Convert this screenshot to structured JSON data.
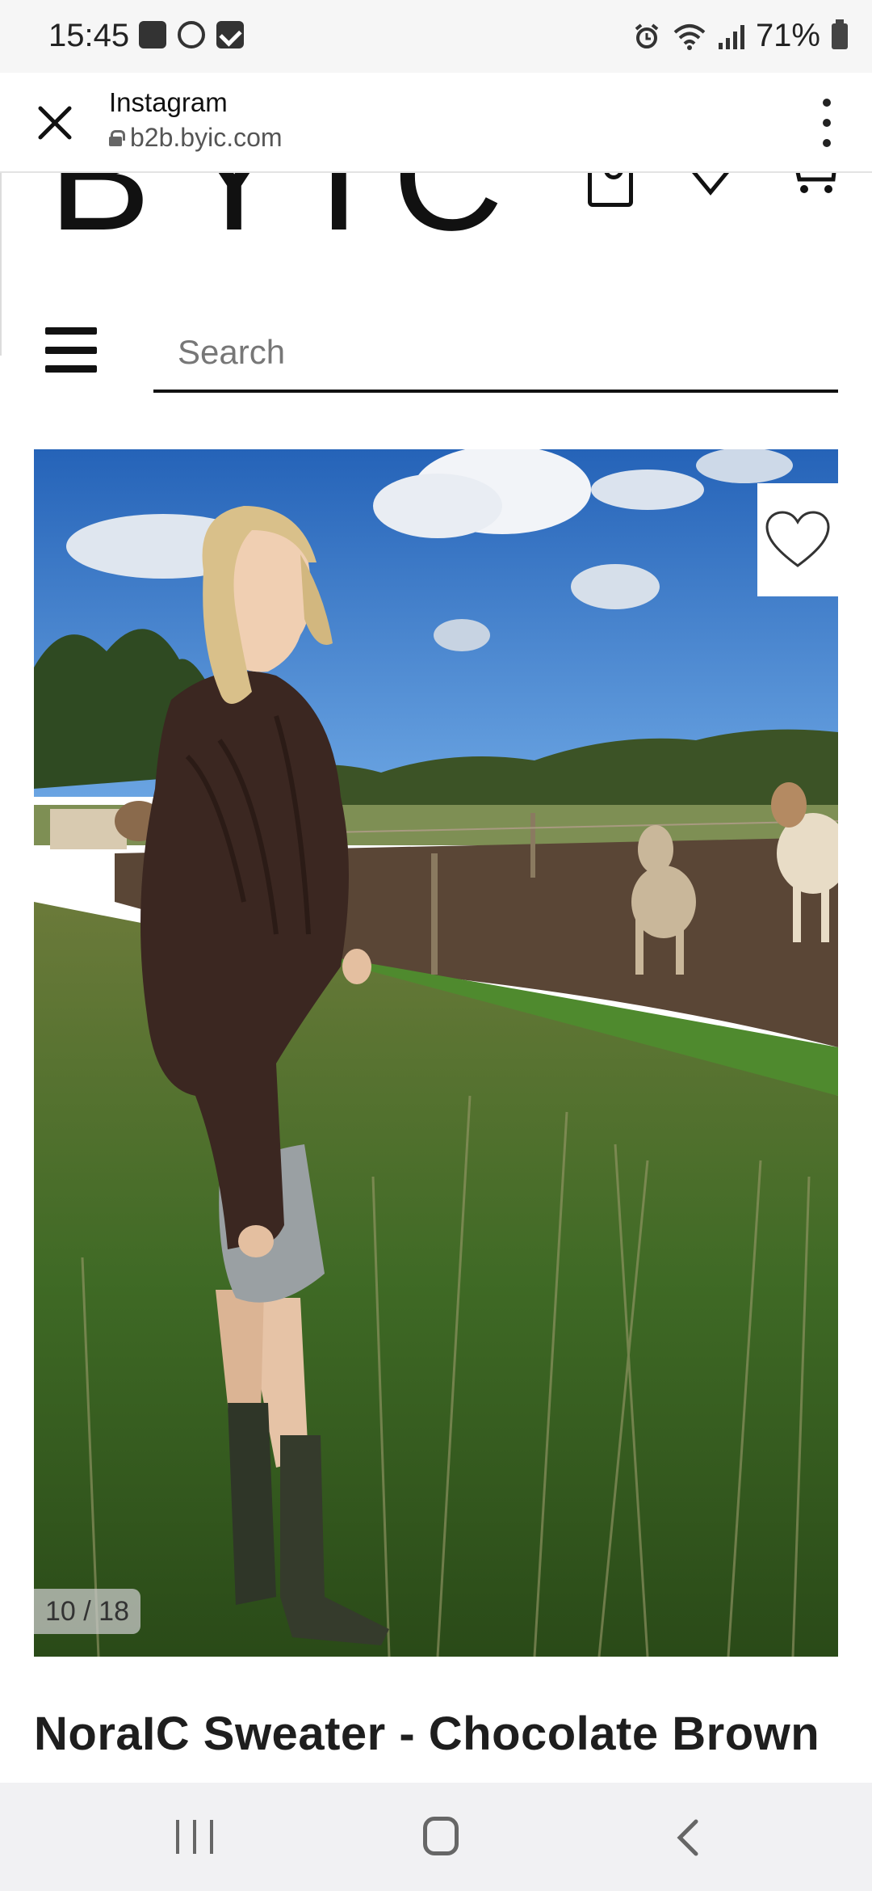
{
  "status_bar": {
    "time": "15:45",
    "battery": "71%",
    "icons_left": [
      "gallery-icon",
      "accessibility-icon",
      "checkbox-icon"
    ],
    "icons_right": [
      "alarm-icon",
      "wifi-icon",
      "signal-icon",
      "battery-icon"
    ]
  },
  "browser": {
    "app_name": "Instagram",
    "url": "b2b.byic.com",
    "close_icon": "close-icon",
    "menu_icon": "more-vertical-icon"
  },
  "site": {
    "logo": "BYIC",
    "header_icons": [
      "account-icon",
      "heart-icon",
      "cart-icon"
    ],
    "menu_icon": "hamburger-icon",
    "search": {
      "placeholder": "Search",
      "value": ""
    }
  },
  "product": {
    "image_counter": "10 / 18",
    "image_index": 10,
    "image_total": 18,
    "title": "NoraIC Sweater - Chocolate Brown",
    "wishlist_icon": "heart-outline-icon"
  },
  "nav_bar": {
    "buttons": [
      "recent-apps-icon",
      "home-icon",
      "back-icon"
    ]
  },
  "colors": {
    "status_bar_bg": "#f6f6f6",
    "nav_bar_bg": "#f1f1f3",
    "text_primary": "#1e1e1e",
    "sweater_brown": "#3b2721",
    "sky_blue": "#2e6fc4"
  }
}
